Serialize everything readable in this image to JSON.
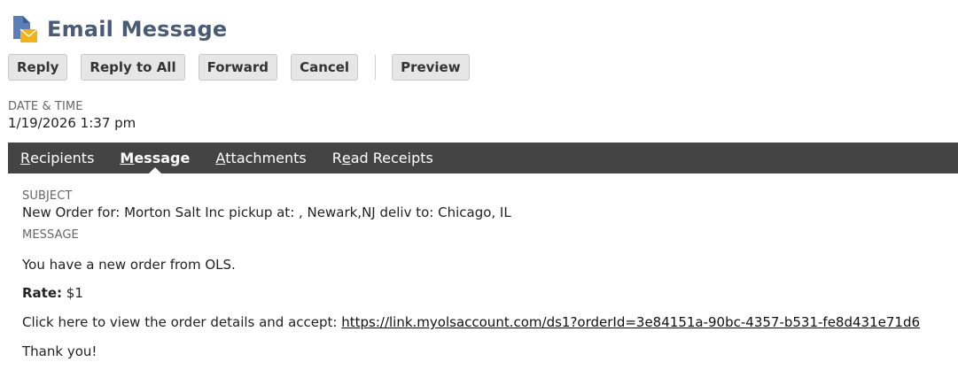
{
  "header": {
    "title": "Email Message",
    "icon": "email-document-icon",
    "title_color": "#4a5b76"
  },
  "toolbar": {
    "reply_label": "Reply",
    "reply_all_label": "Reply to All",
    "forward_label": "Forward",
    "cancel_label": "Cancel",
    "preview_label": "Preview"
  },
  "date": {
    "label": "DATE & TIME",
    "value": "1/19/2026 1:37 pm"
  },
  "tabs": [
    {
      "key": "R",
      "rest": "ecipients",
      "label": "Recipients",
      "active": false
    },
    {
      "key": "M",
      "rest": "essage",
      "label": "Message",
      "active": true
    },
    {
      "key": "A",
      "rest": "ttachments",
      "label": "Attachments",
      "active": false
    },
    {
      "key": "R",
      "rest_pre": "",
      "key2": "e",
      "rest": "ad Receipts",
      "label": "Read Receipts",
      "active": false
    }
  ],
  "message": {
    "subject_label": "SUBJECT",
    "subject": "New Order for: Morton Salt Inc pickup at: , Newark,NJ deliv to: Chicago, IL",
    "message_label": "MESSAGE",
    "line1": "You have a new order from OLS.",
    "rate_label": "Rate:",
    "rate_value": " $1",
    "details_text": "Click here to view the order details and accept: ",
    "details_link": "https://link.myolsaccount.com/ds1?orderId=3e84151a-90bc-4357-b531-fe8d431e71d6",
    "closing": "Thank you!"
  },
  "colors": {
    "tabs_bar": "#444444",
    "button_bg": "#e6e6e6"
  }
}
